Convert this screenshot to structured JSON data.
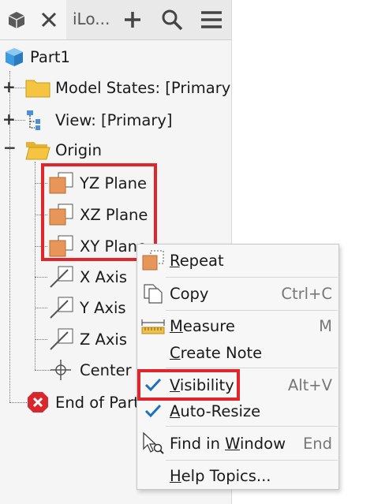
{
  "tabbar": {
    "tab_title": "iLo...",
    "icons": [
      "cube-icon",
      "close-icon",
      "add-icon",
      "search-icon",
      "menu-icon"
    ]
  },
  "tree": {
    "root": "Part1",
    "model_states": "Model States: [Primary]",
    "view": "View: [Primary]",
    "origin": "Origin",
    "yz_plane": "YZ Plane",
    "xz_plane": "XZ Plane",
    "xy_plane": "XY Plane",
    "x_axis": "X Axis",
    "y_axis": "Y Axis",
    "z_axis": "Z Axis",
    "center": "Center",
    "end_of_part": "End of Part"
  },
  "context_menu": {
    "repeat": {
      "pre": "",
      "u": "R",
      "post": "epeat",
      "shortcut": ""
    },
    "copy": {
      "pre": "Copy",
      "u": "",
      "post": "",
      "shortcut": "Ctrl+C"
    },
    "measure": {
      "pre": "",
      "u": "M",
      "post": "easure",
      "shortcut": "M"
    },
    "create_note": {
      "pre": "",
      "u": "C",
      "post": "reate Note",
      "shortcut": ""
    },
    "visibility": {
      "pre": "",
      "u": "V",
      "post": "isibility",
      "shortcut": "Alt+V",
      "checked": true
    },
    "auto_resize": {
      "pre": "",
      "u": "A",
      "post": "uto-Resize",
      "shortcut": "",
      "checked": true
    },
    "find_in_window": {
      "pre": "Find in ",
      "u": "W",
      "post": "indow",
      "shortcut": "End"
    },
    "help_topics": {
      "pre": "",
      "u": "H",
      "post": "elp Topics...",
      "shortcut": ""
    }
  },
  "colors": {
    "highlight": "#e0262b",
    "folder": "#f5c542",
    "plane": "#e8955a",
    "check": "#1f6fc0",
    "part_cube": "#3d9be0",
    "end_of_part": "#d9272e"
  }
}
